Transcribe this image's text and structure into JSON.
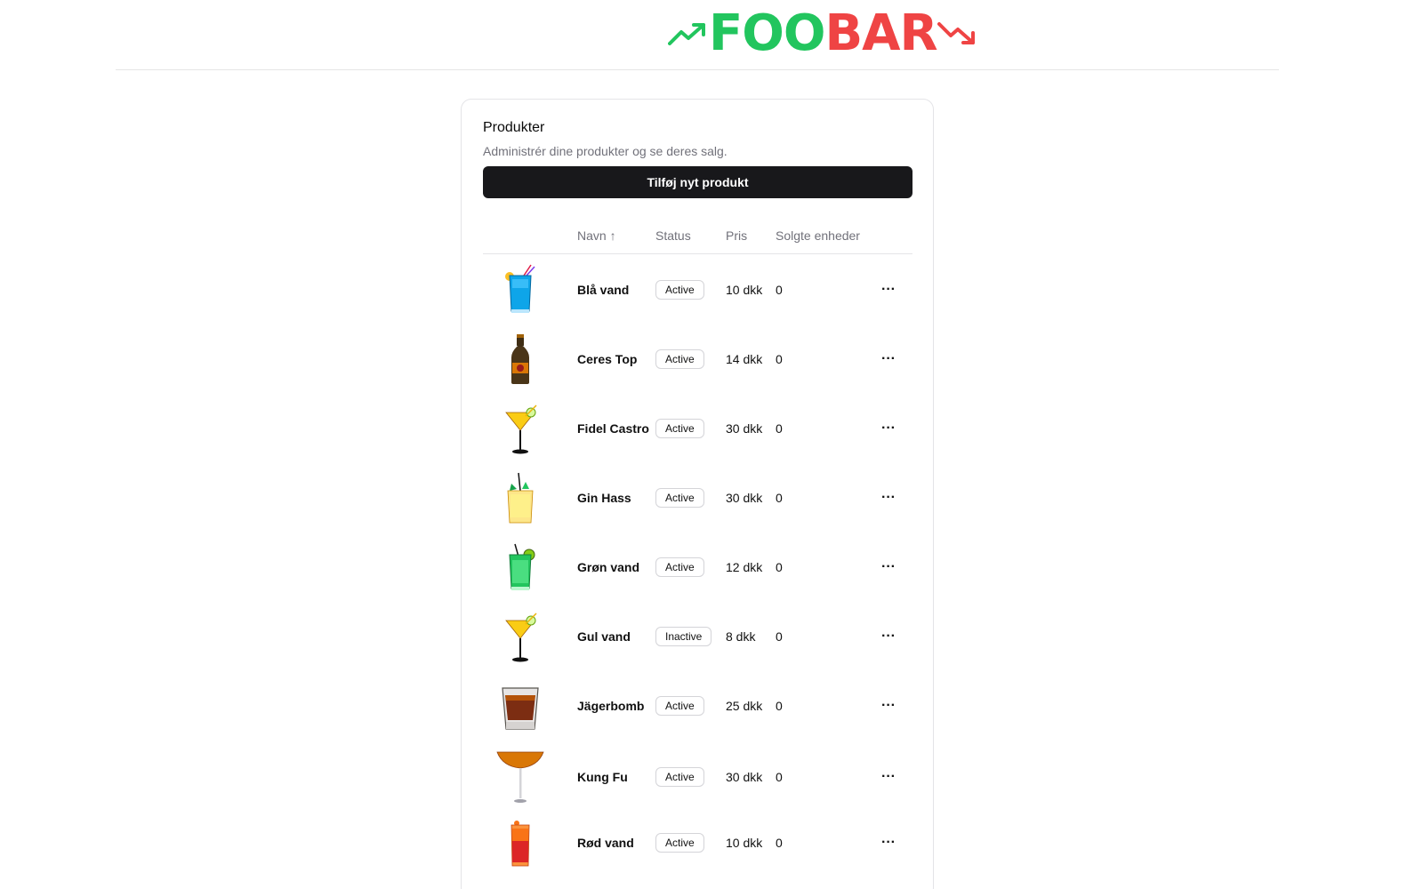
{
  "brand": {
    "part1": "FOO",
    "part2": "BAR",
    "color_up": "#22c55e",
    "color_down": "#ef4444",
    "icon_left": "trending-up-icon",
    "icon_right": "trending-down-icon"
  },
  "card": {
    "title": "Produkter",
    "description": "Administrér dine produkter og se deres salg.",
    "add_button": "Tilføj nyt produkt"
  },
  "table": {
    "columns": {
      "image": "",
      "name": "Navn ↑",
      "status": "Status",
      "price": "Pris",
      "sold": "Solgte enheder"
    },
    "rows": [
      {
        "name": "Blå vand",
        "status": "Active",
        "price": "10 dkk",
        "sold": "0",
        "image": "blue-drink"
      },
      {
        "name": "Ceres Top",
        "status": "Active",
        "price": "14 dkk",
        "sold": "0",
        "image": "beer-bottle"
      },
      {
        "name": "Fidel Castro",
        "status": "Active",
        "price": "30 dkk",
        "sold": "0",
        "image": "yellow-cocktail"
      },
      {
        "name": "Gin Hass",
        "status": "Active",
        "price": "30 dkk",
        "sold": "0",
        "image": "gin-highball"
      },
      {
        "name": "Grøn vand",
        "status": "Active",
        "price": "12 dkk",
        "sold": "0",
        "image": "green-drink"
      },
      {
        "name": "Gul vand",
        "status": "Inactive",
        "price": "8 dkk",
        "sold": "0",
        "image": "yellow-cocktail"
      },
      {
        "name": "Jägerbomb",
        "status": "Active",
        "price": "25 dkk",
        "sold": "0",
        "image": "shot-glass"
      },
      {
        "name": "Kung Fu",
        "status": "Active",
        "price": "30 dkk",
        "sold": "0",
        "image": "orange-cocktail"
      },
      {
        "name": "Rød vand",
        "status": "Active",
        "price": "10 dkk",
        "sold": "0",
        "image": "red-drink"
      }
    ],
    "row_action_icon": "more-horizontal-icon"
  }
}
